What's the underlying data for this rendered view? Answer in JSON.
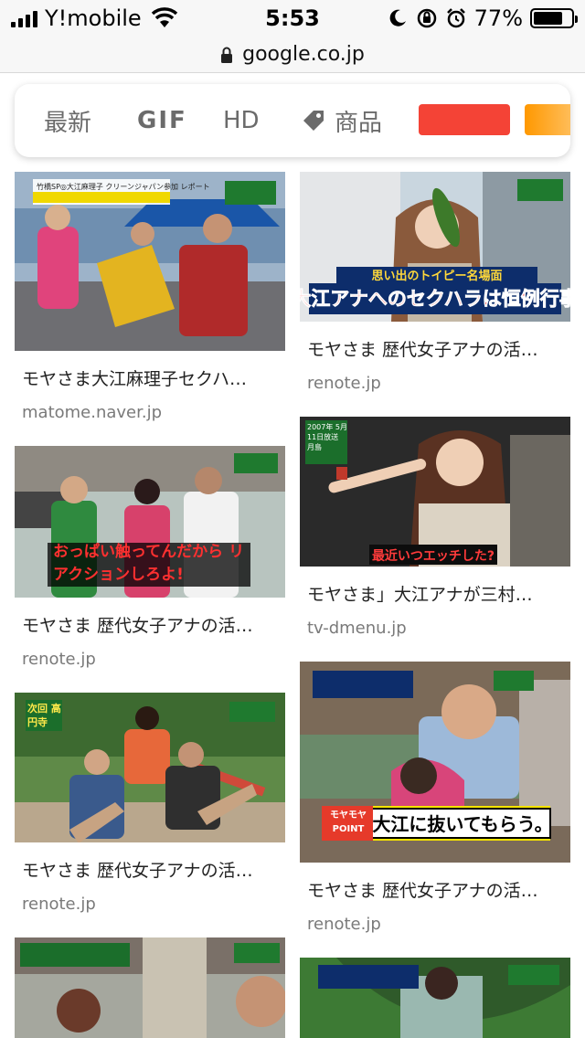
{
  "status": {
    "carrier": "Y!mobile",
    "time": "5:53",
    "battery_pct": "77%",
    "battery_level": 0.77
  },
  "browser": {
    "url": "google.co.jp"
  },
  "filters": {
    "latest": "最新",
    "gif": "GIF",
    "hd": "HD",
    "products": "商品",
    "color_swatches": [
      "#f44336",
      "#ff9800"
    ]
  },
  "results": [
    {
      "title": "モヤさま大江麻理子セクハ…",
      "source": "matome.naver.jp",
      "caption_top": "竹橋SP◎大江麻理子 クリーンジャパン参加 レポート"
    },
    {
      "title": "モヤさま 歴代女子アナの活…",
      "source": "renote.jp",
      "caption": "大江アナへのセクハラは恒例行事",
      "caption_small": "思い出のトイピー名場面"
    },
    {
      "title": "モヤさま 歴代女子アナの活…",
      "source": "renote.jp",
      "caption": "おっぱい触ってんだから リアクションしろよ!"
    },
    {
      "title": "モヤさま」大江アナが三村…",
      "source": "tv-dmenu.jp",
      "caption": "最近いつエッチした?",
      "badge": "2007年 5月11日放送 月島"
    },
    {
      "title": "モヤさま 歴代女子アナの活…",
      "source": "renote.jp",
      "badge": "次回 高円寺"
    },
    {
      "title": "モヤさま 歴代女子アナの活…",
      "source": "renote.jp",
      "caption": "大江に抜いてもらう。",
      "badge": "モヤモヤ POINT"
    },
    {
      "title": "",
      "source": ""
    },
    {
      "title": "",
      "source": ""
    }
  ]
}
